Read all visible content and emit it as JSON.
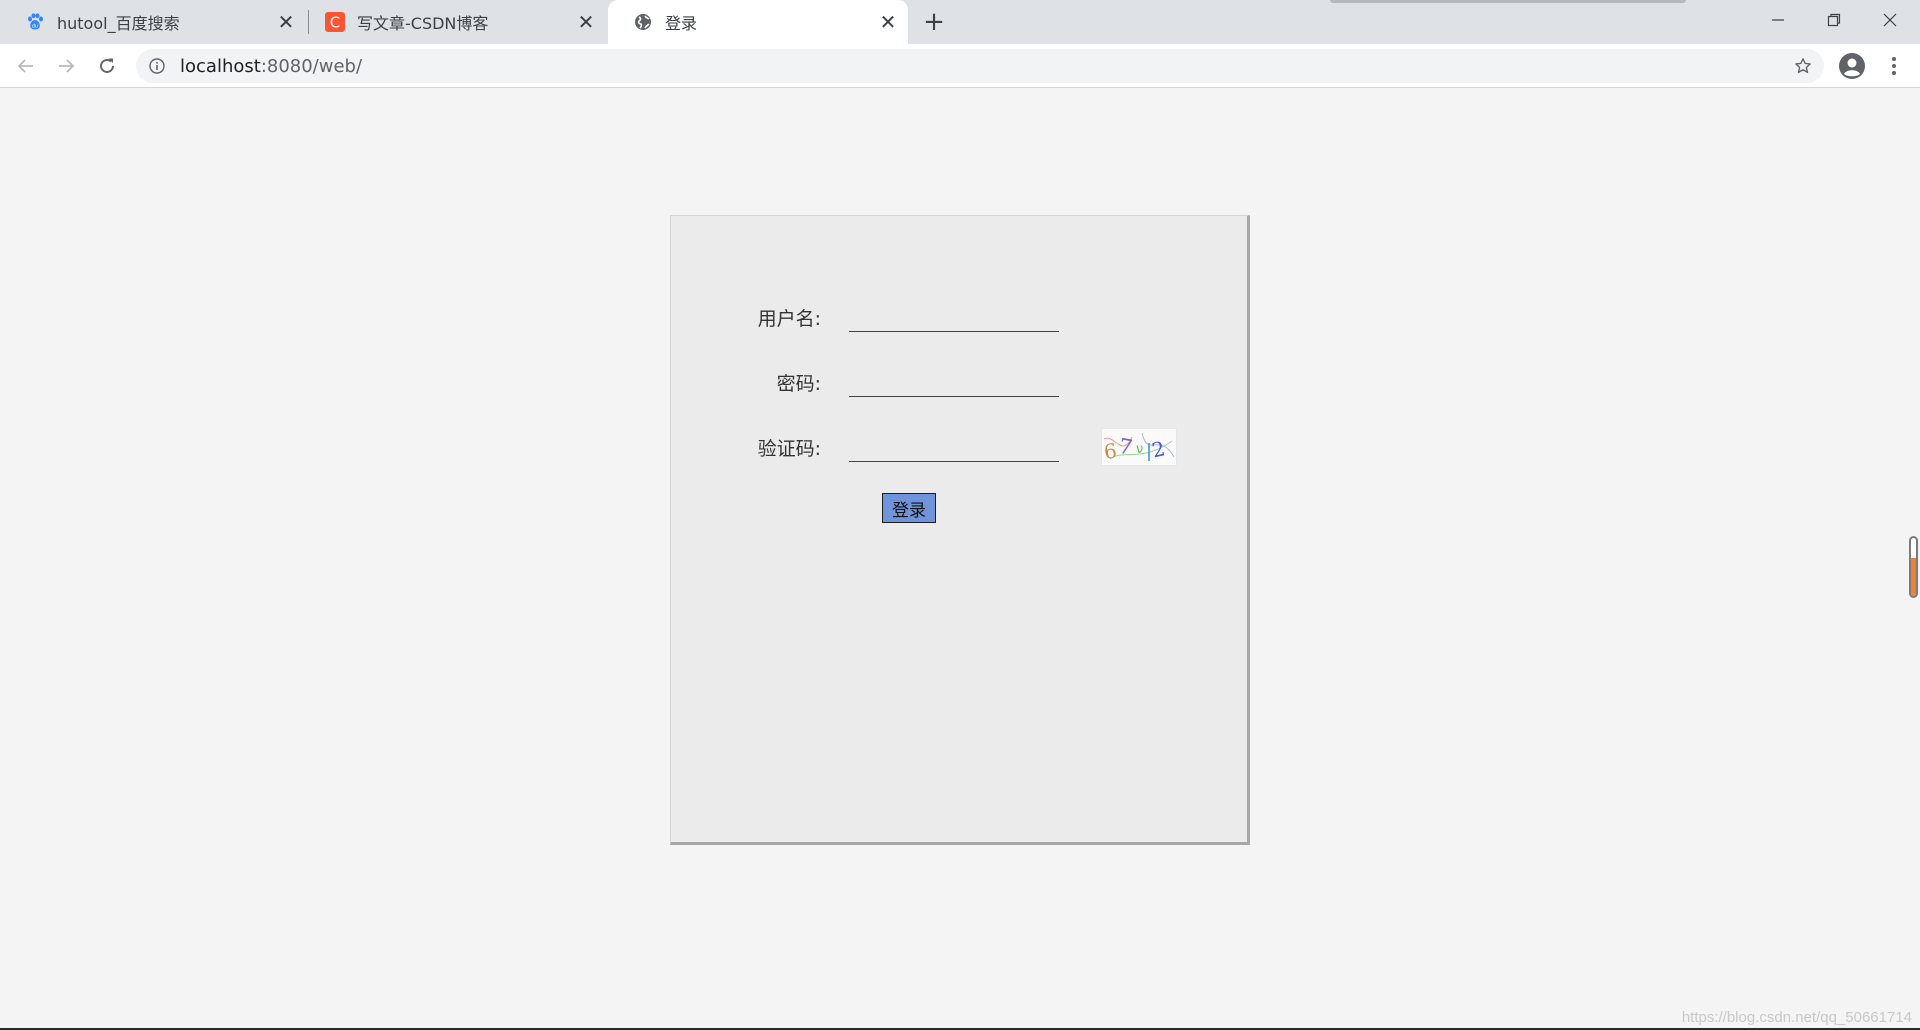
{
  "browser": {
    "tabs": [
      {
        "title": "hutool_百度搜索",
        "icon": "baidu-paw-icon",
        "active": false
      },
      {
        "title": "写文章-CSDN博客",
        "icon": "csdn-c-icon",
        "active": false
      },
      {
        "title": "登录",
        "icon": "globe-icon",
        "active": true
      }
    ],
    "new_tab_label": "+",
    "close_label": "✕",
    "url_host": "localhost",
    "url_path": ":8080/web/"
  },
  "login": {
    "username_label": "用户名:",
    "username_value": "",
    "password_label": "密码:",
    "password_value": "",
    "captcha_label": "验证码:",
    "captcha_value": "",
    "captcha_text": "67ν2",
    "submit_label": "登录"
  },
  "watermark": "https://blog.csdn.net/qq_50661714",
  "colors": {
    "panel_bg": "#ebebeb",
    "button_bg": "#6f94dc",
    "csdn_red": "#fc5531",
    "baidu_blue": "#3385ff"
  }
}
